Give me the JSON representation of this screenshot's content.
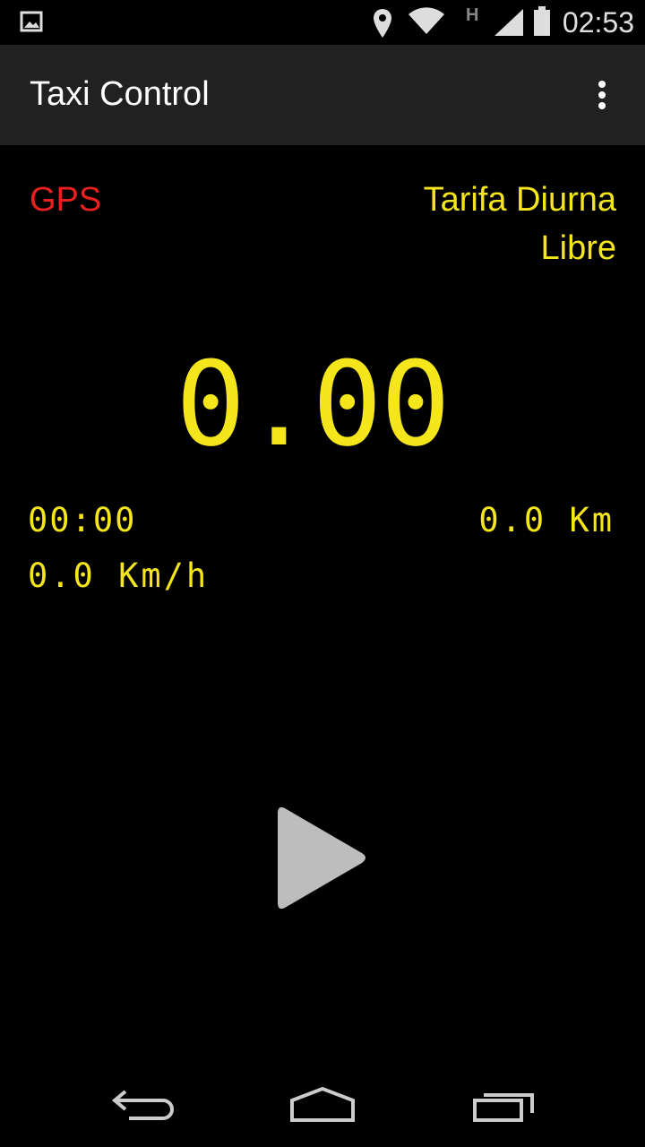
{
  "status_bar": {
    "time": "02:53",
    "icons": [
      "image-icon",
      "location-icon",
      "wifi-icon",
      "h-network-icon",
      "signal-icon",
      "battery-icon"
    ]
  },
  "action_bar": {
    "title": "Taxi Control",
    "menu_icon": "overflow-menu-icon"
  },
  "meter": {
    "gps_label": "GPS",
    "tariff": "Tarifa Diurna",
    "state": "Libre",
    "fare": "0.00",
    "elapsed_time": "00:00",
    "distance": "0.0 Km",
    "speed": "0.0 Km/h"
  },
  "controls": {
    "play_icon": "play-icon"
  },
  "nav_bar": {
    "icons": [
      "back-icon",
      "home-icon",
      "recents-icon"
    ]
  },
  "colors": {
    "led": "#f5e61b",
    "gps": "#e8211f",
    "actionbar": "#212121",
    "play": "#bdbdbd"
  }
}
